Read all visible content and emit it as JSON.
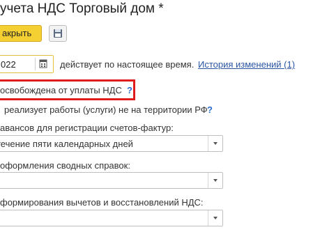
{
  "window": {
    "title": "учета НДС Торговый дом *"
  },
  "toolbar": {
    "close_label": "акрыть",
    "save_icon": "floppy-disk-icon"
  },
  "period": {
    "date_value": "022",
    "calendar_icon": "calendar-icon",
    "status_text": "действует по настоящее время.",
    "history_link": "История изменений (1)"
  },
  "options": {
    "exempt_label": "освобождена от уплаты НДС",
    "exempt_help": "?",
    "abroad_label": "реализует работы (услуги) не на территории РФ",
    "abroad_help": "?"
  },
  "fields": [
    {
      "label": "авансов для регистрации счетов-фактур:",
      "value": "течение пяти календарных дней"
    },
    {
      "label": "оформления сводных справок:",
      "value": ""
    },
    {
      "label": "формирования вычетов и восстановлений НДС:",
      "value": ""
    }
  ],
  "colors": {
    "accent_button": "#f4d033",
    "highlight_border": "#e01b1b",
    "link": "#2a55a3",
    "help": "#2a6bd1"
  }
}
